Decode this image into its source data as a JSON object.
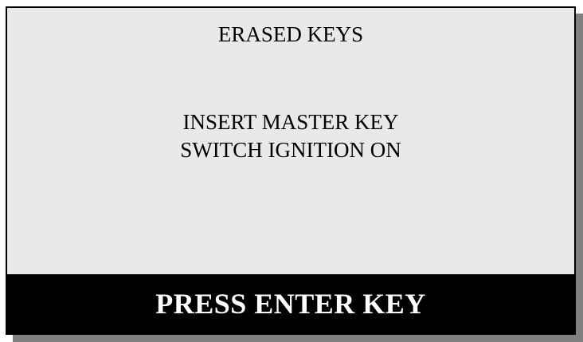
{
  "screen": {
    "title": "ERASED KEYS",
    "message_lines": [
      "INSERT MASTER KEY",
      "SWITCH IGNITION ON"
    ],
    "prompt": "PRESS ENTER KEY"
  },
  "colors": {
    "screen_background": "#e9e9e9",
    "border": "#000000",
    "footer_background": "#000000",
    "footer_text": "#ffffff",
    "shadow": "#808080"
  }
}
